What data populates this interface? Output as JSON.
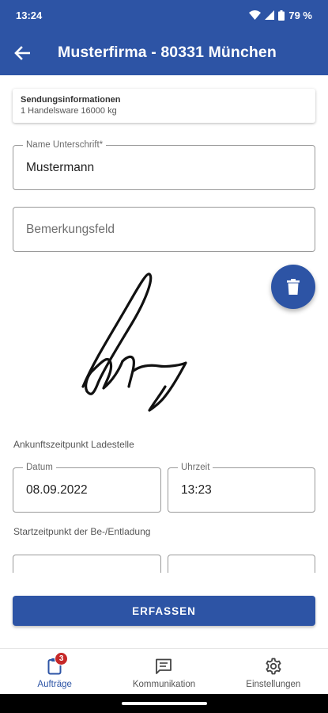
{
  "status_bar": {
    "time": "13:24",
    "battery": "79 %"
  },
  "app_bar": {
    "title": "Musterfirma - 80331 München"
  },
  "shipment": {
    "title": "Sendungsinformationen",
    "info": "1 Handelsware 16000 kg"
  },
  "form": {
    "name_label": "Name Unterschrift*",
    "name_value": "Mustermann",
    "remarks_placeholder": "Bemerkungsfeld",
    "arrival_section": "Ankunftszeitpunkt Ladestelle",
    "date_label": "Datum",
    "date_value": "08.09.2022",
    "time_label": "Uhrzeit",
    "time_value": "13:23",
    "start_section": "Startzeitpunkt der Be-/Entladung"
  },
  "actions": {
    "submit_label": "ERFASSEN"
  },
  "bottom_nav": {
    "items": [
      {
        "label": "Aufträge",
        "icon": "clipboard-icon",
        "badge": "3",
        "active": true
      },
      {
        "label": "Kommunikation",
        "icon": "chat-icon"
      },
      {
        "label": "Einstellungen",
        "icon": "gear-icon"
      }
    ]
  },
  "colors": {
    "primary": "#2d54a5",
    "badge": "#c62828"
  }
}
